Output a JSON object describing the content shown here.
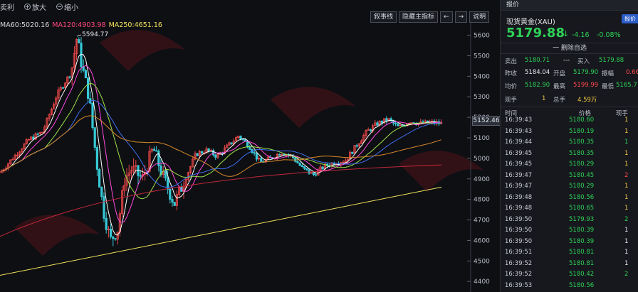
{
  "toolbar": {
    "items": [
      "卖利",
      "放大",
      "缩小"
    ],
    "buttons": [
      "叙事线",
      "隐藏主指标",
      "←",
      "→",
      "说明"
    ]
  },
  "ma_legend": [
    {
      "label": "MA60:5020.16",
      "color": "#d6d6d6"
    },
    {
      "label": "MA120:4903.98",
      "color": "#ff4a7a"
    },
    {
      "label": "MA250:4651.16",
      "color": "#f3e05a"
    }
  ],
  "chart_data": {
    "type": "candlestick",
    "y_ticks": [
      5600,
      5500,
      5400,
      5300,
      5200,
      5100,
      5000,
      4900,
      4800,
      4700,
      4600,
      4500,
      4400
    ],
    "ylim": [
      4380,
      5640
    ],
    "high_annotation": "5594.77",
    "current_price_tag": "5152.46"
  },
  "quote": {
    "tab": "报价",
    "symbol": "现货黄金(XAU)",
    "tag": "报价",
    "last": "5179.88",
    "change": "-4.16",
    "change_pct": "-0.08%",
    "watch_label": "一 删除自选",
    "sell_label": "卖出",
    "sell": "5180.71",
    "sell_extra": "---",
    "buy_label": "买入",
    "buy": "5179.88",
    "prev_close_label": "昨收",
    "prev_close": "5184.04",
    "open_label": "开盘",
    "open": "5179.90",
    "amp_label": "振幅",
    "amp": "0.66",
    "avg_label": "均价",
    "avg": "5182.90",
    "high_label": "最高",
    "high": "5199.99",
    "low_label": "最低",
    "low": "5165.7",
    "cur_vol_label": "现手",
    "cur_vol": "1",
    "total_vol_label": "总手",
    "total_vol": "4.59万"
  },
  "ticks": {
    "headers": [
      "时间",
      "价格",
      "现手"
    ],
    "rows": [
      {
        "time": "16:39:43",
        "price": "5180.60",
        "vol": "1",
        "color": "#f3c744"
      },
      {
        "time": "16:39:43",
        "price": "5180.19",
        "vol": "1",
        "color": "#f3c744"
      },
      {
        "time": "16:39:44",
        "price": "5180.35",
        "vol": "1",
        "color": "#2fd158"
      },
      {
        "time": "16:39:45",
        "price": "5180.35",
        "vol": "1",
        "color": "#f3c744"
      },
      {
        "time": "16:39:45",
        "price": "5180.29",
        "vol": "1",
        "color": "#f3c744"
      },
      {
        "time": "16:39:47",
        "price": "5180.45",
        "vol": "2",
        "color": "#ff4a4a"
      },
      {
        "time": "16:39:47",
        "price": "5180.29",
        "vol": "1",
        "color": "#f3c744"
      },
      {
        "time": "16:39:48",
        "price": "5180.56",
        "vol": "1",
        "color": "#f3c744"
      },
      {
        "time": "16:39:48",
        "price": "5180.65",
        "vol": "1",
        "color": "#f3c744"
      },
      {
        "time": "16:39:50",
        "price": "5179.93",
        "vol": "2",
        "color": "#2fd158"
      },
      {
        "time": "16:39:50",
        "price": "5180.39",
        "vol": "1",
        "color": "#e4e7ee"
      },
      {
        "time": "16:39:50",
        "price": "5180.39",
        "vol": "1",
        "color": "#e4e7ee"
      },
      {
        "time": "16:39:51",
        "price": "5180.81",
        "vol": "1",
        "color": "#e4e7ee"
      },
      {
        "time": "16:39:52",
        "price": "5180.81",
        "vol": "1",
        "color": "#e4e7ee"
      },
      {
        "time": "16:39:52",
        "price": "5180.42",
        "vol": "2",
        "color": "#2fd158"
      },
      {
        "time": "16:39:53",
        "price": "5180.56",
        "vol": "",
        "color": "#e4e7ee"
      }
    ]
  }
}
